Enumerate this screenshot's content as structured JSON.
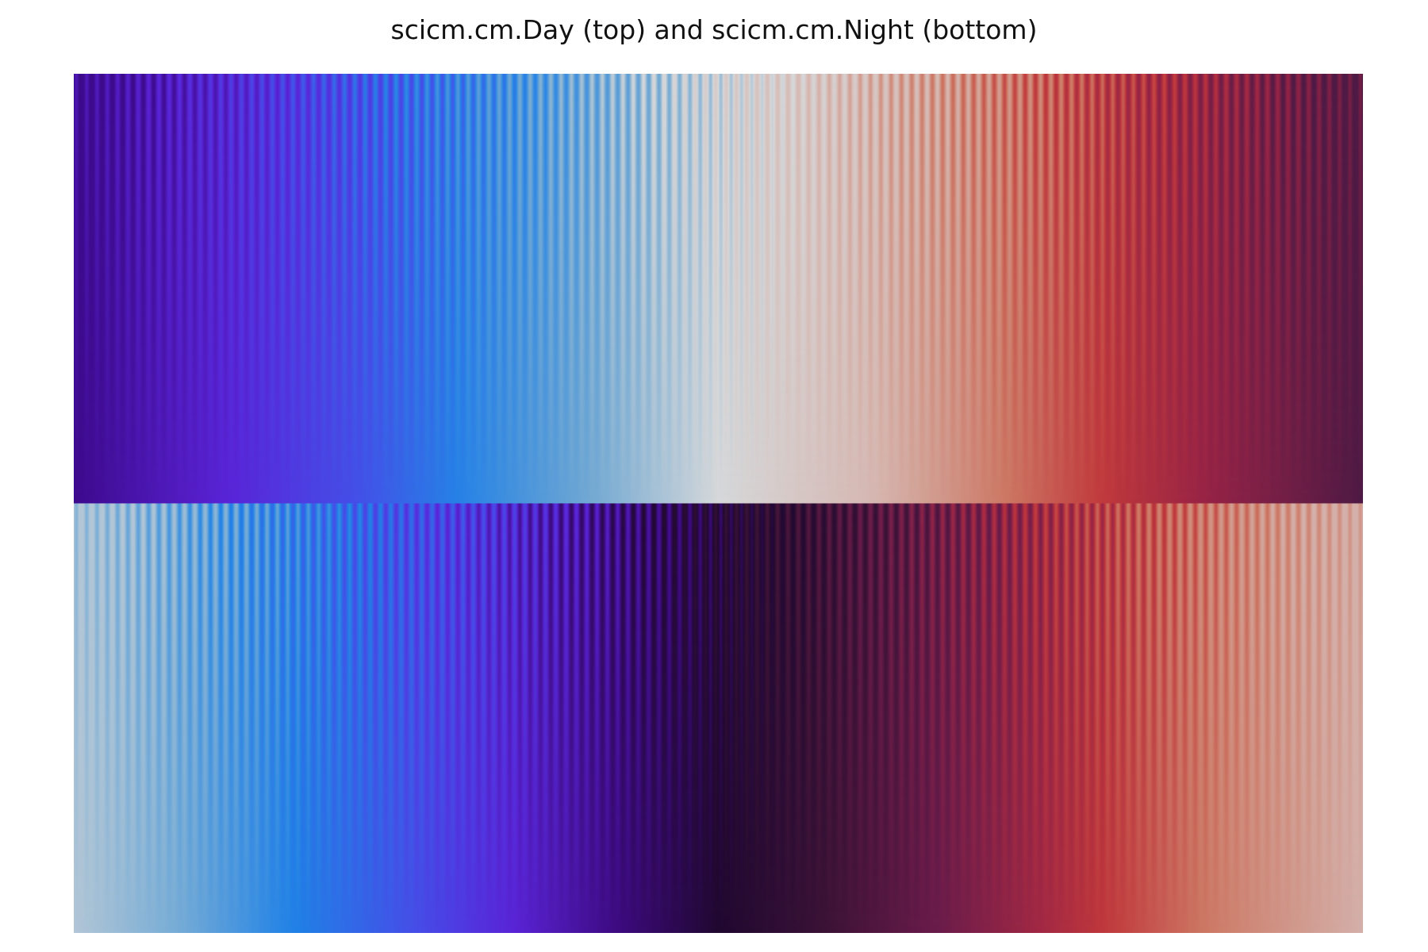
{
  "chart_data": {
    "type": "heatmap",
    "title": "scicm.cm.Day (top) and scicm.cm.Night (bottom)",
    "xlabel": "",
    "ylabel": "",
    "axes_visible": false,
    "description_of_test_pattern": "colormap test image: sinusoidal stripes superimposed on a linear ramp; stripe amplitude decreases from top to bottom of each panel",
    "panels": [
      {
        "name": "scicm.cm.Day",
        "position": "top",
        "colormap_stops": [
          [
            0.0,
            "#3d0a8c"
          ],
          [
            0.12,
            "#5a24d8"
          ],
          [
            0.22,
            "#4450e8"
          ],
          [
            0.3,
            "#2583e6"
          ],
          [
            0.4,
            "#71a8d2"
          ],
          [
            0.5,
            "#d6d8da"
          ],
          [
            0.62,
            "#d6b8b2"
          ],
          [
            0.72,
            "#cd7a66"
          ],
          [
            0.8,
            "#c0383b"
          ],
          [
            0.88,
            "#962346"
          ],
          [
            1.0,
            "#4e1a45"
          ]
        ]
      },
      {
        "name": "scicm.cm.Night",
        "position": "bottom",
        "colormap_stops": [
          [
            0.0,
            "#b2c6d6"
          ],
          [
            0.08,
            "#77acd6"
          ],
          [
            0.17,
            "#1f82e6"
          ],
          [
            0.26,
            "#4450e8"
          ],
          [
            0.34,
            "#5a24d8"
          ],
          [
            0.42,
            "#3e0b82"
          ],
          [
            0.5,
            "#200830"
          ],
          [
            0.58,
            "#3a1236"
          ],
          [
            0.67,
            "#6a1c4a"
          ],
          [
            0.75,
            "#a22844"
          ],
          [
            0.8,
            "#c0383b"
          ],
          [
            0.88,
            "#cd7a66"
          ],
          [
            1.0,
            "#d4b0aa"
          ]
        ]
      }
    ],
    "stripe_count": 125,
    "stripe_amplitude_top": 0.06,
    "stripe_amplitude_bottom": 0.0
  }
}
